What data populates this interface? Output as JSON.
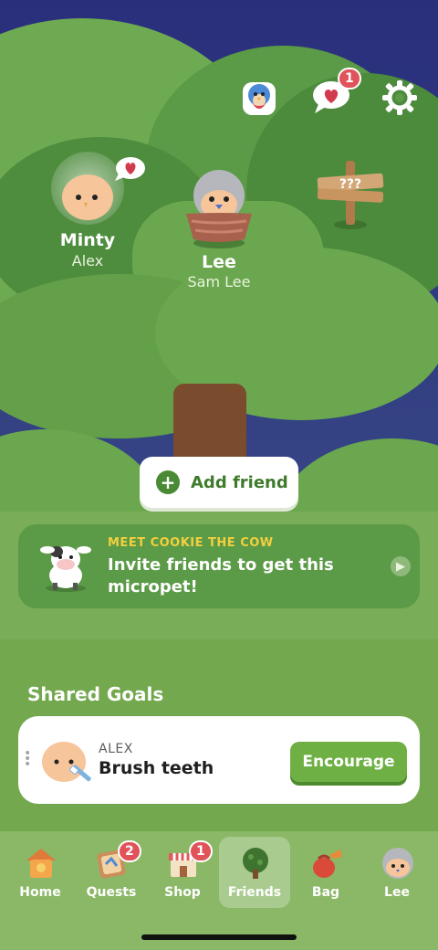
{
  "header": {
    "notifications_badge": "1",
    "icons": [
      "profile-bird-icon",
      "heart-message-icon",
      "gear-icon"
    ]
  },
  "friends": [
    {
      "name": "Minty",
      "subtitle": "Alex"
    },
    {
      "name": "Lee",
      "subtitle": "Sam Lee"
    }
  ],
  "sign_text": "???",
  "add_friend": {
    "label": "Add friend"
  },
  "promo": {
    "kicker": "MEET COOKIE THE COW",
    "text": "Invite friends to get this micropet!"
  },
  "shared_goals": {
    "title": "Shared Goals",
    "items": [
      {
        "person": "ALEX",
        "task": "Brush teeth",
        "action": "Encourage"
      }
    ]
  },
  "tabbar": {
    "items": [
      {
        "label": "Home",
        "icon": "birdhouse-icon",
        "badge": ""
      },
      {
        "label": "Quests",
        "icon": "quest-map-icon",
        "badge": "2"
      },
      {
        "label": "Shop",
        "icon": "shop-icon",
        "badge": "1"
      },
      {
        "label": "Friends",
        "icon": "tree-icon",
        "badge": "",
        "active": true
      },
      {
        "label": "Bag",
        "icon": "bag-icon",
        "badge": ""
      },
      {
        "label": "Lee",
        "icon": "pet-avatar-icon",
        "badge": ""
      }
    ]
  },
  "colors": {
    "accent_green": "#6fb045",
    "badge_red": "#e0535a",
    "kicker_yellow": "#f3cf3f"
  }
}
